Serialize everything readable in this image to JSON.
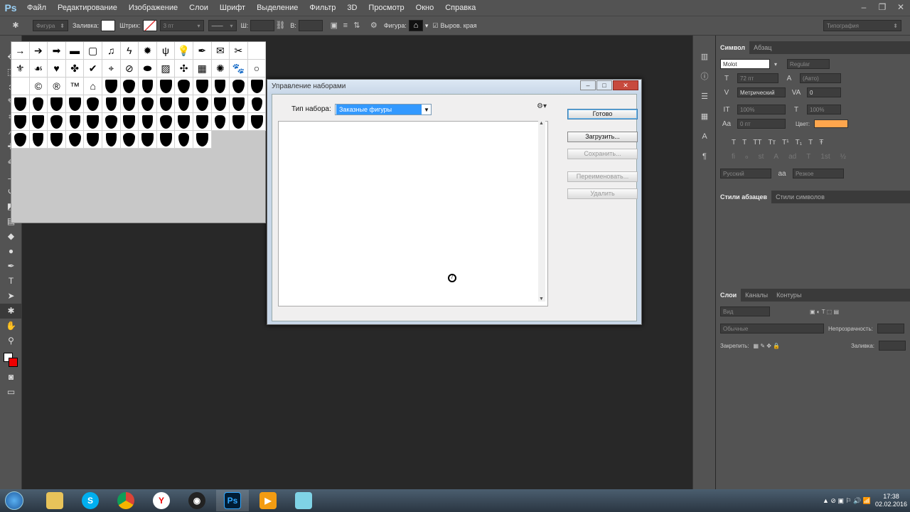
{
  "app": {
    "logo": "Ps"
  },
  "menu": [
    "Файл",
    "Редактирование",
    "Изображение",
    "Слои",
    "Шрифт",
    "Выделение",
    "Фильтр",
    "3D",
    "Просмотр",
    "Окно",
    "Справка"
  ],
  "options": {
    "mode": "Фигура",
    "fill_label": "Заливка:",
    "stroke_label": "Штрих:",
    "stroke_size": "3 пт",
    "w_label": "Ш:",
    "h_label": "В:",
    "shape_label": "Фигура:",
    "align_edges": "Выров. края",
    "workspace": "Типография"
  },
  "panels": {
    "char_tabs": [
      "Символ",
      "Абзац"
    ],
    "font": "Molot",
    "style": "Regular",
    "size": "72 пт",
    "leading": "(Авто)",
    "kerning": "Метрический",
    "tracking": "0",
    "vscale": "100%",
    "hscale": "100%",
    "baseline": "0 пт",
    "color_label": "Цвет:",
    "color_value": "#ffa64d",
    "lang": "Русский",
    "aa": "Резкое",
    "style_tabs": [
      "Стили абзацев",
      "Стили символов"
    ],
    "layer_tabs": [
      "Слои",
      "Каналы",
      "Контуры"
    ],
    "layer_kind": "Вид",
    "blend": "Обычные",
    "opacity_label": "Непрозрачность:",
    "lock_label": "Закрепить:",
    "fill_label": "Заливка:"
  },
  "dialog": {
    "title": "Управление наборами",
    "type_label": "Тип набора:",
    "type_value": "Заказные фигуры",
    "buttons": {
      "done": "Готово",
      "load": "Загрузить...",
      "save": "Сохранить...",
      "rename": "Переименовать...",
      "delete": "Удалить"
    }
  },
  "shapes_row1": [
    "→",
    "➔",
    "➡",
    "▬",
    "▢",
    "♫",
    "ϟ",
    "✹",
    "ψ",
    "💡",
    "✒",
    "✉",
    "✂",
    ""
  ],
  "shapes_row2": [
    "⚜",
    "☙",
    "♥",
    "✤",
    "✔",
    "⌖",
    "⊘",
    "⬬",
    "▨",
    "✣",
    "▦",
    "✺",
    "🐾",
    "○"
  ],
  "shapes_row3": [
    "",
    "©",
    "®",
    "™",
    "⌂"
  ],
  "shield_count": 48,
  "tray": {
    "time": "17:38",
    "date": "02.02.2016"
  }
}
